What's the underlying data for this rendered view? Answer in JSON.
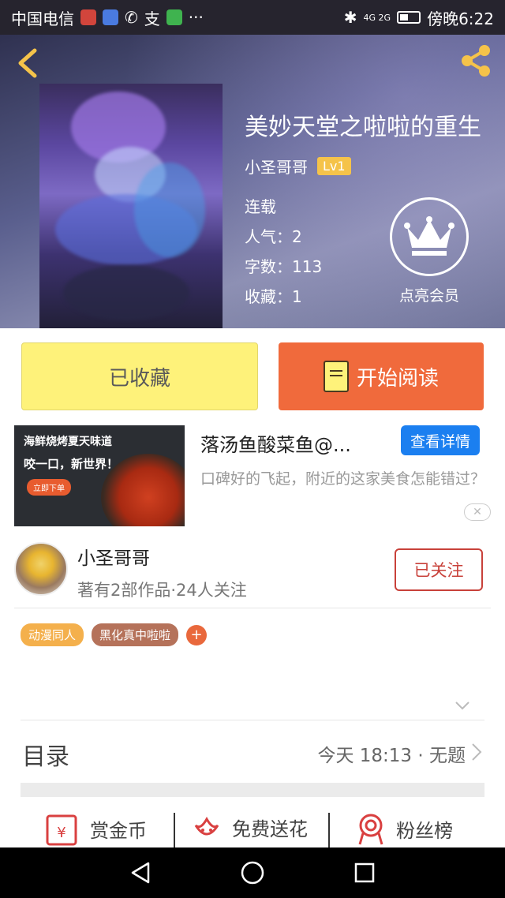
{
  "status_bar": {
    "carrier": "中国电信",
    "more": "···",
    "network": "4G 2G",
    "time": "傍晚6:22"
  },
  "header": {
    "back_icon": "chevron-left-icon",
    "share_icon": "share-icon"
  },
  "book": {
    "title": "美妙天堂之啦啦的重生",
    "author": "小圣哥哥",
    "level": "Lv1",
    "status": "连载",
    "popularity": "人气：2",
    "word_count": "字数：113",
    "favorites": "收藏：1",
    "vip_label": "点亮会员"
  },
  "actions": {
    "collected": "已收藏",
    "read": "开始阅读"
  },
  "ad": {
    "image_line1": "海鲜烧烤夏天味道",
    "image_line2": "咬一口，新世界！",
    "image_order": "立即下单",
    "title": "落汤鱼酸菜鱼@...",
    "detail_button": "查看详情",
    "description": "口碑好的飞起，附近的这家美食怎能错过？",
    "close": "✕"
  },
  "author": {
    "name": "小圣哥哥",
    "info": "著有2部作品·24人关注",
    "follow": "已关注"
  },
  "tags": [
    "动漫同人",
    "黑化真中啦啦"
  ],
  "tag_add": "+",
  "toc": {
    "label": "目录",
    "latest": "今天 18:13 · 无题"
  },
  "bottom": {
    "reward": "赏金币",
    "flower": "免费送花",
    "fans": "粉丝榜"
  },
  "colors": {
    "accent_orange": "#f06a3c",
    "collected_yellow": "#fef27a",
    "follow_red": "#c8413a",
    "ad_blue": "#1b7ff0"
  }
}
